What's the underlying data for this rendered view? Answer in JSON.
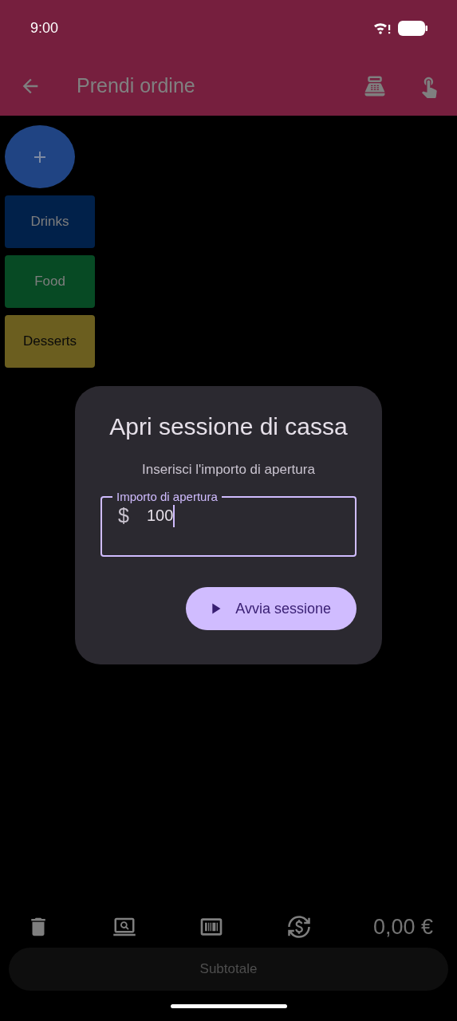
{
  "status_bar": {
    "time": "9:00"
  },
  "app_bar": {
    "title": "Prendi ordine"
  },
  "categories": [
    {
      "label": "Drinks",
      "color": "#01214a"
    },
    {
      "label": "Food",
      "color": "#074a24"
    },
    {
      "label": "Desserts",
      "color": "#6b5e1f"
    }
  ],
  "dialog": {
    "title": "Apri sessione di cassa",
    "message": "Inserisci l'importo di apertura",
    "field": {
      "label": "Importo di apertura",
      "prefix": "$",
      "value": "100"
    },
    "button": "Avvia sessione"
  },
  "toolbar": {
    "total": "0,00 €"
  },
  "subtotal_button": {
    "label": "Subtotale",
    "disabled": true
  }
}
